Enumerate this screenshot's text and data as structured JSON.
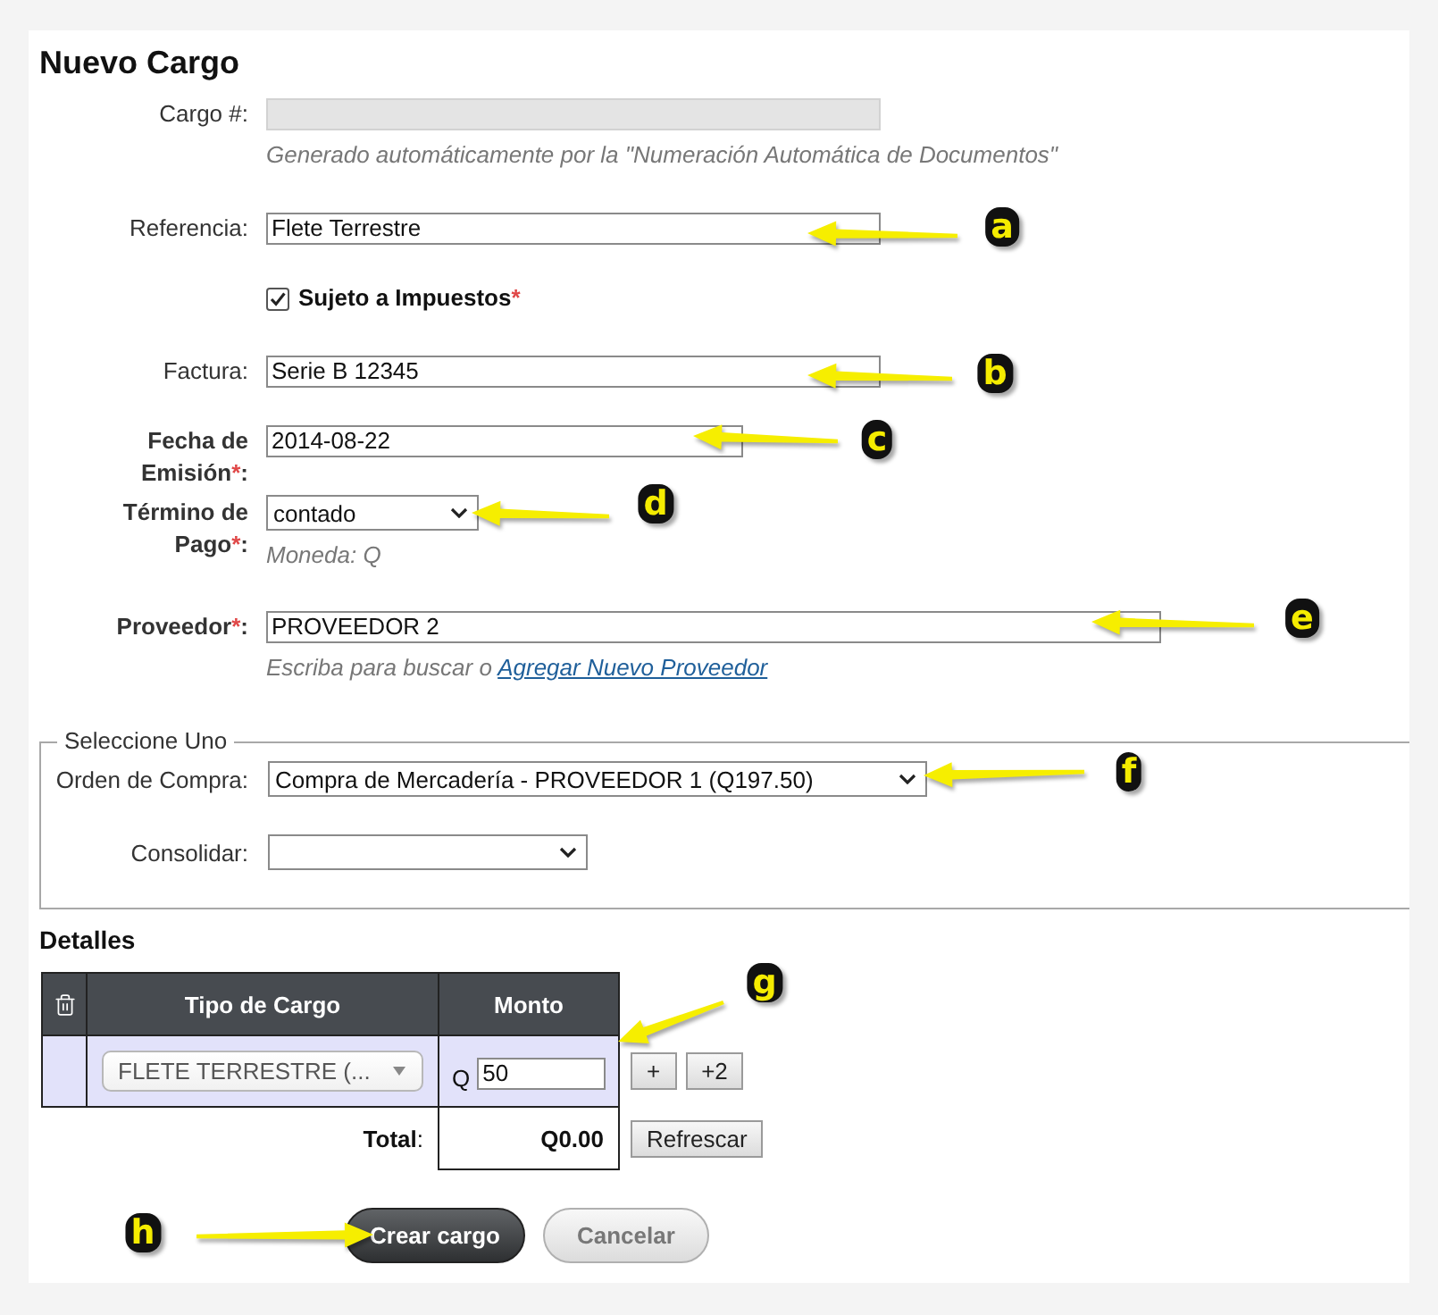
{
  "title": "Nuevo Cargo",
  "fields": [
    {
      "kind": "text",
      "label": "Cargo #:",
      "disabled": true,
      "hint": "Generado automáticamente por la \"Numeración Automática de Documentos\""
    },
    {
      "kind": "text",
      "label": "Referencia:",
      "value": "Flete Terrestre",
      "disabled": false
    },
    {
      "kind": "checkbox",
      "label": "Sujeto a Impuestos",
      "required_mark": "*",
      "checked": true,
      "disabled": false
    },
    {
      "kind": "text",
      "label": "Factura:",
      "value": "Serie B 12345",
      "disabled": false
    },
    {
      "kind": "date",
      "label": "Fecha de Emisión",
      "required_mark": "*",
      "label_suffix": ":",
      "value": "2014-08-22",
      "disabled": false
    },
    {
      "kind": "select",
      "label": "Término de Pago",
      "required_mark": "*",
      "label_suffix": ":",
      "value": "contado",
      "hint": "Moneda: Q",
      "disabled": false
    },
    {
      "kind": "lookup",
      "label": "Proveedor",
      "required_mark": "*",
      "label_suffix": ":",
      "value": "PROVEEDOR 2",
      "hint": "Escriba para buscar o",
      "hint_link": "Agregar Nuevo Proveedor",
      "disabled": false
    }
  ],
  "selection": {
    "legend": "Seleccione Uno",
    "fields": [
      {
        "label": "Orden de Compra:",
        "value": "Compra de Mercadería - PROVEEDOR 1 (Q197.50)"
      },
      {
        "label": "Consolidar:"
      }
    ]
  },
  "details": {
    "title": "Detalles",
    "columns": [
      "Tipo de Cargo",
      "Monto"
    ],
    "rows": [
      {
        "charge_type": "FLETE TERRESTRE (...",
        "currency": "Q",
        "amount": "50"
      }
    ],
    "row_buttons": [
      "+",
      "+2"
    ],
    "total_label": "**Total**:",
    "total": "Q0.00",
    "refresh_button": "Refrescar"
  },
  "actions": [
    {
      "label": "Crear cargo",
      "kind": "primary"
    },
    {
      "label": "Cancelar",
      "kind": "secondary"
    }
  ],
  "callouts": [
    {
      "label": "a"
    },
    {
      "label": "b"
    },
    {
      "label": "c"
    },
    {
      "label": "d"
    },
    {
      "label": "e"
    },
    {
      "label": "f"
    },
    {
      "label": "g"
    },
    {
      "label": "h"
    }
  ]
}
